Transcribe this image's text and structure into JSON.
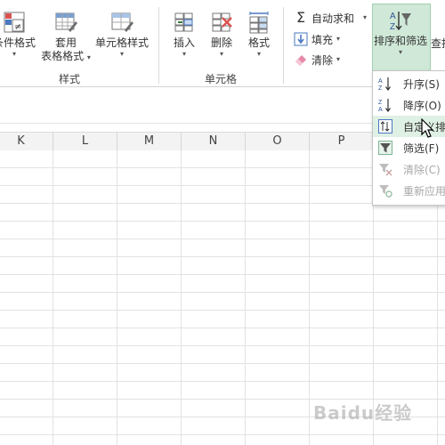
{
  "ribbon": {
    "conditional_format_label": "条件格式",
    "table_format_line1": "套用",
    "table_format_line2": "表格格式",
    "cell_styles_label": "单元格样式",
    "styles_group_label": "样式",
    "insert_label": "插入",
    "delete_label": "删除",
    "format_label": "格式",
    "cells_group_label": "单元格",
    "autosum_label": "自动求和",
    "fill_label": "填充",
    "clear_label": "清除",
    "sort_filter_label": "排序和筛选",
    "find_select_label": "查找"
  },
  "columns": [
    "K",
    "L",
    "M",
    "N",
    "O",
    "P"
  ],
  "sort_menu": {
    "items": [
      {
        "label": "升序(S)",
        "icon": "sort-ascending-icon",
        "disabled": false
      },
      {
        "label": "降序(O)",
        "icon": "sort-descending-icon",
        "disabled": false
      },
      {
        "label": "自定义排序",
        "icon": "custom-sort-icon",
        "disabled": false,
        "hover": true
      },
      {
        "label": "筛选(F)",
        "icon": "filter-icon",
        "disabled": false
      },
      {
        "label": "清除(C)",
        "icon": "clear-filter-icon",
        "disabled": true
      },
      {
        "label": "重新应用",
        "icon": "reapply-icon",
        "disabled": true
      }
    ]
  },
  "watermark": "Baidu经验",
  "colors": {
    "accent_green": "#217346",
    "sort_button_bg": "#cfe8d7",
    "grid_line": "#e2e2e2"
  }
}
